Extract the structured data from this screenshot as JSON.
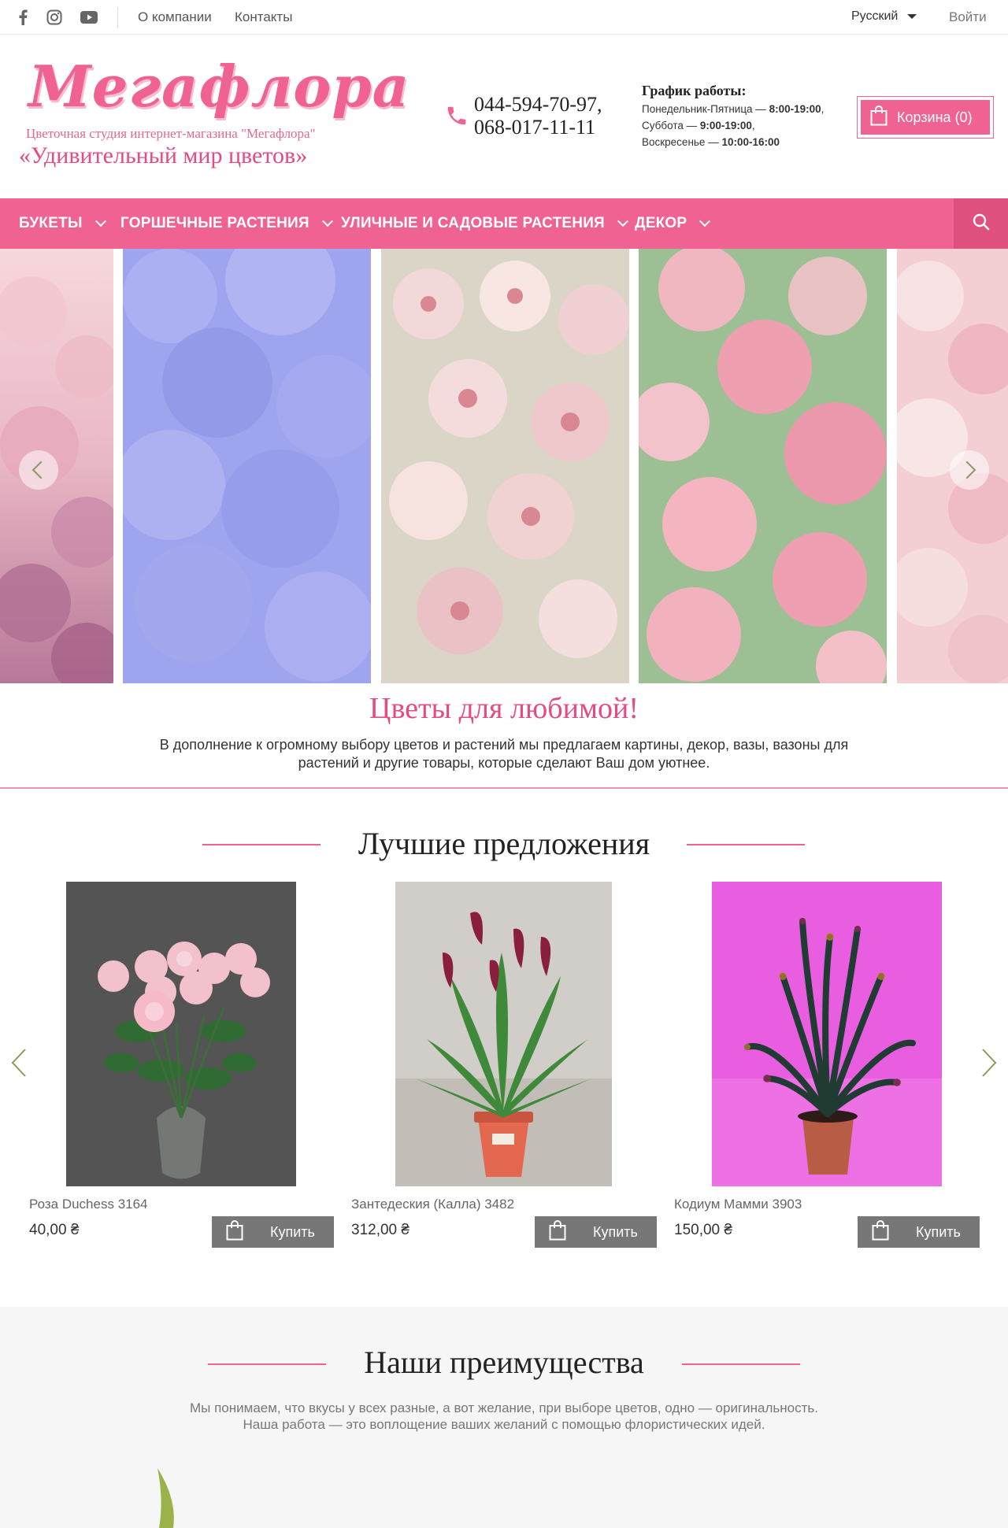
{
  "topbar": {
    "social": [
      "facebook-icon",
      "instagram-icon",
      "youtube-icon"
    ],
    "links": [
      "О компании",
      "Контакты"
    ],
    "language": "Русский",
    "login": "Войти"
  },
  "header": {
    "logo": "Мегафлора",
    "subtitle": "Цветочная студия интернет-магазина \"Мегафлора\"",
    "slogan": "«Удивительный мир цветов»",
    "phone_1": "044-594-70-97,",
    "phone_2": "068-017-11-11",
    "schedule": {
      "title": "График работы:",
      "rows": [
        {
          "days": "Понедельник-Пятница — ",
          "hours": "8:00-19:00",
          "tail": ","
        },
        {
          "days": "Суббота — ",
          "hours": "9:00-19:00",
          "tail": ","
        },
        {
          "days": "Воскресенье — ",
          "hours": "10:00-16:00",
          "tail": ""
        }
      ]
    },
    "cart_label": "Корзина (0)"
  },
  "nav": {
    "items": [
      "БУКЕТЫ",
      "ГОРШЕЧНЫЕ РАСТЕНИЯ",
      "УЛИЧНЫЕ И САДОВЫЕ РАСТЕНИЯ",
      "ДЕКОР"
    ]
  },
  "promo": {
    "title": "Цветы для любимой!",
    "text": "В дополнение к огромному выбору цветов и растений мы предлагаем картины, декор, вазы, вазоны для растений и другие товары, которые сделают Ваш дом уютнее."
  },
  "offers": {
    "title": "Лучшие предложения",
    "buy_label": "Купить",
    "products": [
      {
        "name": "Роза Duchess 3164",
        "price": "40,00 ₴"
      },
      {
        "name": "Зантедеския (Калла) 3482",
        "price": "312,00 ₴"
      },
      {
        "name": "Кодиум Мамми 3903",
        "price": "150,00 ₴"
      }
    ]
  },
  "advantages": {
    "title": "Наши преимущества",
    "line1": "Мы понимаем, что вкусы у всех разные, а вот желание, при выборе цветов, одно — оригинальность.",
    "line2": "Наша работа — это воплощение ваших желаний с помощью флористических идей."
  },
  "colors": {
    "accent": "#f06292",
    "button_gray": "#777777",
    "slider_arrow": "#8a9a5b"
  }
}
